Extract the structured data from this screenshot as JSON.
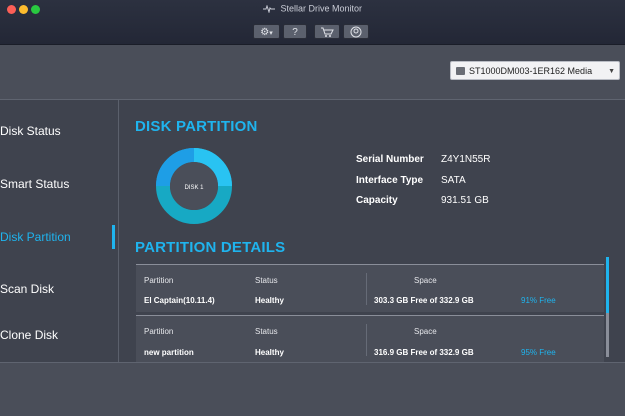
{
  "window": {
    "title": "Stellar Drive Monitor"
  },
  "toolbar": {
    "settings_icon": "gear-icon",
    "help_label": "?",
    "cart_icon": "cart-icon",
    "account_icon": "account-icon"
  },
  "disk_selector": {
    "selected": "ST1000DM003-1ER162 Media"
  },
  "sidebar": {
    "items": [
      {
        "label": "Disk Status"
      },
      {
        "label": "Smart Status"
      },
      {
        "label": "Disk Partition",
        "active": true
      },
      {
        "label": "Scan Disk"
      },
      {
        "label": "Clone Disk"
      }
    ]
  },
  "disk_partition": {
    "title": "DISK PARTITION",
    "donut_label": "DISK 1",
    "info": {
      "serial_label": "Serial Number",
      "serial_value": "Z4Y1N55R",
      "interface_label": "Interface Type",
      "interface_value": "SATA",
      "capacity_label": "Capacity",
      "capacity_value": "931.51 GB"
    }
  },
  "partition_details": {
    "title": "PARTITION DETAILS",
    "headers": {
      "partition": "Partition",
      "status": "Status",
      "space": "Space"
    },
    "rows": [
      {
        "name": "El Captain(10.11.4)",
        "status": "Healthy",
        "space": "303.3 GB Free of 332.9 GB",
        "free_pct": "91% Free"
      },
      {
        "name": "new partition",
        "status": "Healthy",
        "space": "316.9 GB Free of 332.9 GB",
        "free_pct": "95% Free"
      }
    ]
  },
  "colors": {
    "accent": "#1fb4ee",
    "background": "#3f434e"
  }
}
